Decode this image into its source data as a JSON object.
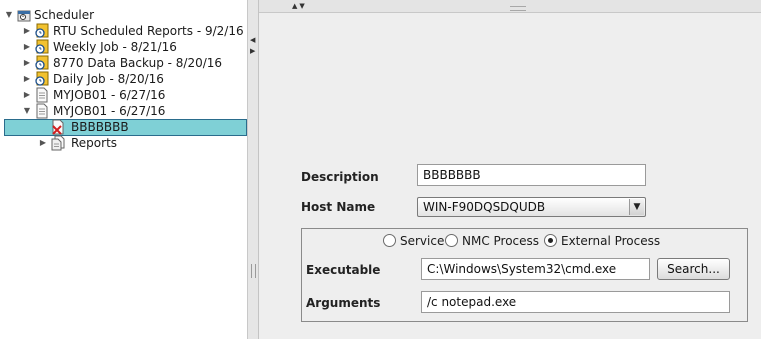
{
  "tree": {
    "root": {
      "label": "Scheduler",
      "icon": "scheduler-icon"
    },
    "items": [
      {
        "label": "RTU Scheduled Reports - 9/2/16",
        "icon": "job-clock-icon"
      },
      {
        "label": "Weekly Job - 8/21/16",
        "icon": "job-clock-icon"
      },
      {
        "label": "8770 Data Backup - 8/20/16",
        "icon": "job-clock-icon"
      },
      {
        "label": "Daily Job - 8/20/16",
        "icon": "job-clock-icon"
      },
      {
        "label": "MYJOB01 - 6/27/16",
        "icon": "document-icon"
      },
      {
        "label": "MYJOB01 - 6/27/16",
        "icon": "document-icon"
      }
    ],
    "children": [
      {
        "label": "BBBBBBB",
        "icon": "task-error-icon",
        "selected": true
      },
      {
        "label": "Reports",
        "icon": "reports-icon"
      }
    ]
  },
  "form": {
    "description_label": "Description",
    "description_value": "BBBBBBB",
    "host_name_label": "Host Name",
    "host_name_value": "WIN-F90DQSDQUDB",
    "radio_options": [
      {
        "label": "Service",
        "selected": false
      },
      {
        "label": "NMC Process",
        "selected": false
      },
      {
        "label": "External Process",
        "selected": true
      }
    ],
    "executable_label": "Executable",
    "executable_value": "C:\\Windows\\System32\\cmd.exe",
    "search_button": "Search...",
    "arguments_label": "Arguments",
    "arguments_value": "/c notepad.exe"
  },
  "colors": {
    "selection": "#7fd0d6",
    "icon_yellow": "#f2c230",
    "icon_blue": "#3a6ea5"
  }
}
